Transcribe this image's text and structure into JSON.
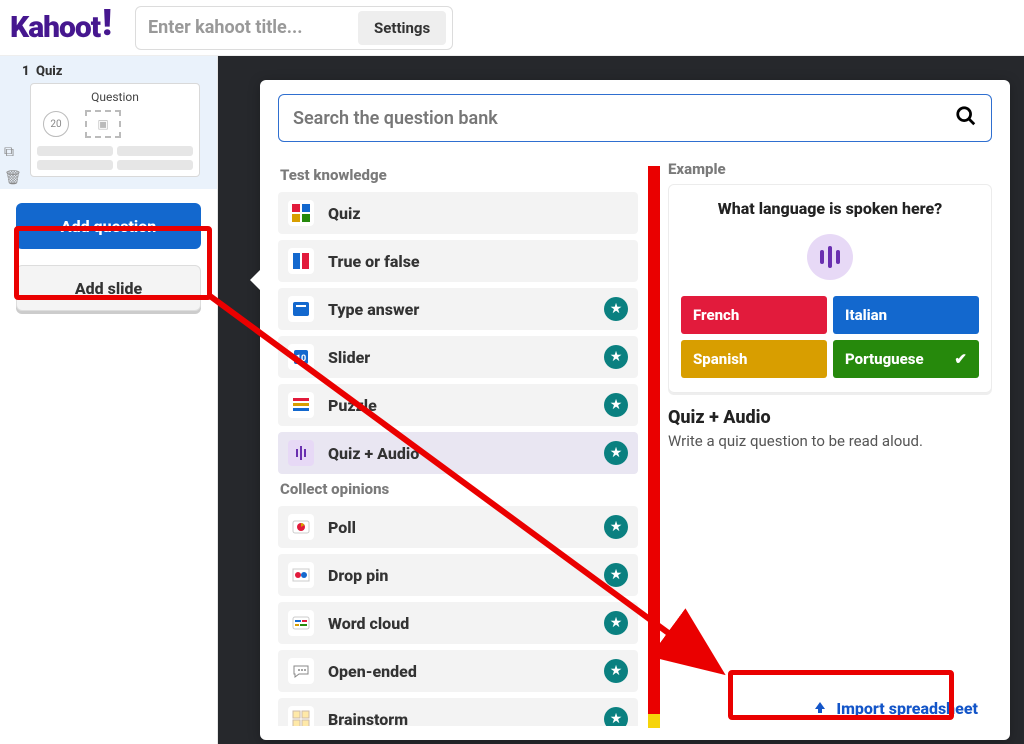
{
  "header": {
    "logo_text": "Kahoot",
    "title_placeholder": "Enter kahoot title...",
    "settings_label": "Settings"
  },
  "sidebar": {
    "slide_index": "1",
    "slide_type": "Quiz",
    "thumb_title": "Question",
    "thumb_time": "20",
    "add_question_label": "Add question",
    "add_slide_label": "Add slide"
  },
  "panel": {
    "search_placeholder": "Search the question bank",
    "group1_label": "Test knowledge",
    "group2_label": "Collect opinions",
    "items_knowledge": [
      {
        "label": "Quiz",
        "starred": false
      },
      {
        "label": "True or false",
        "starred": false
      },
      {
        "label": "Type answer",
        "starred": true
      },
      {
        "label": "Slider",
        "starred": true
      },
      {
        "label": "Puzzle",
        "starred": true
      },
      {
        "label": "Quiz + Audio",
        "starred": true,
        "active": true
      }
    ],
    "items_opinions": [
      {
        "label": "Poll",
        "starred": true
      },
      {
        "label": "Drop pin",
        "starred": true
      },
      {
        "label": "Word cloud",
        "starred": true
      },
      {
        "label": "Open-ended",
        "starred": true
      },
      {
        "label": "Brainstorm",
        "starred": true
      }
    ],
    "example_label": "Example",
    "example_question": "What language is spoken here?",
    "answers": [
      {
        "text": "French",
        "color": "a-red"
      },
      {
        "text": "Italian",
        "color": "a-blue"
      },
      {
        "text": "Spanish",
        "color": "a-yellow"
      },
      {
        "text": "Portuguese",
        "color": "a-green",
        "correct": true
      }
    ],
    "preview_title": "Quiz + Audio",
    "preview_desc": "Write a quiz question to be read aloud.",
    "import_label": "Import spreadsheet"
  },
  "icons": {
    "quiz_colors": [
      "#E21B3C",
      "#1368CE",
      "#D89E00",
      "#26890C"
    ]
  }
}
